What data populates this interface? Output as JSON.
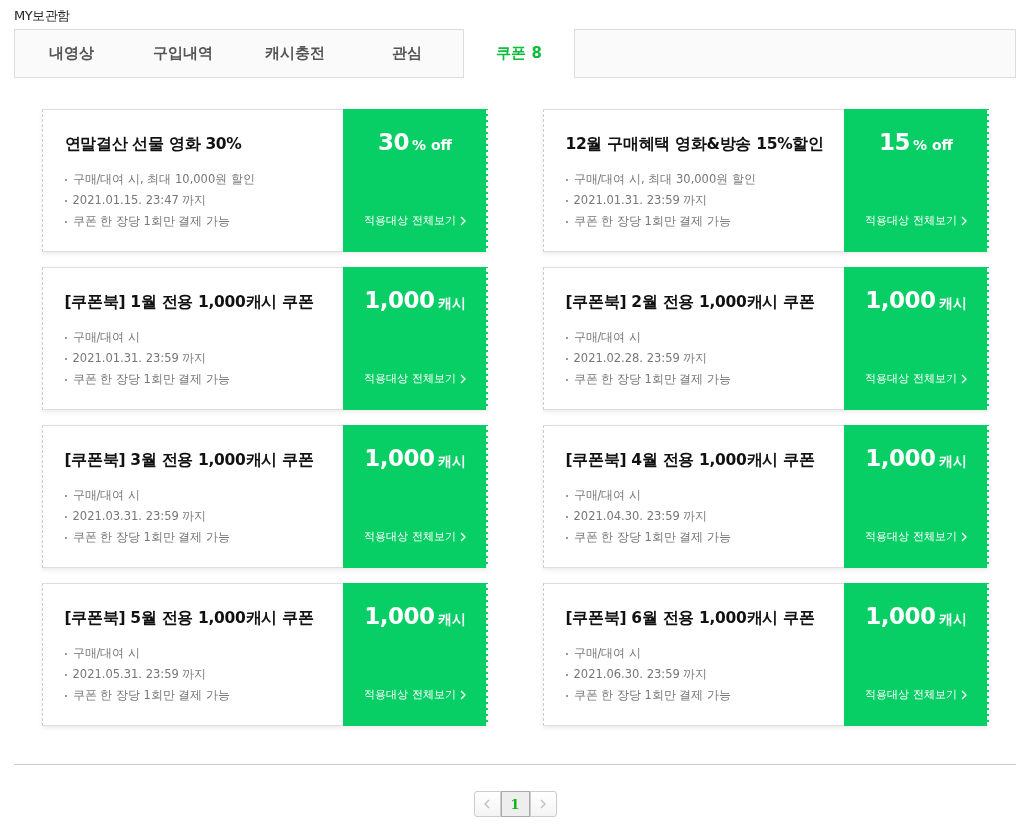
{
  "page_title": "MY보관함",
  "tabs": [
    {
      "label": "내영상",
      "selected": false
    },
    {
      "label": "구입내역",
      "selected": false
    },
    {
      "label": "캐시충전",
      "selected": false
    },
    {
      "label": "관심",
      "selected": false
    },
    {
      "label": "쿠폰 8",
      "selected": true
    }
  ],
  "coupons": [
    {
      "title": "연말결산 선물 영화 30%",
      "details": [
        "구매/대여 시, 최대 10,000원 할인",
        "2021.01.15. 23:47 까지",
        "쿠폰 한 장당 1회만 결제 가능"
      ],
      "amount": "30",
      "unit": "% off",
      "link": "적용대상 전체보기"
    },
    {
      "title": "12월 구매혜택 영화&방송 15%할인",
      "details": [
        "구매/대여 시, 최대 30,000원 할인",
        "2021.01.31. 23:59 까지",
        "쿠폰 한 장당 1회만 결제 가능"
      ],
      "amount": "15",
      "unit": "% off",
      "link": "적용대상 전체보기"
    },
    {
      "title": "[쿠폰북] 1월 전용 1,000캐시 쿠폰",
      "details": [
        "구매/대여 시",
        "2021.01.31. 23:59 까지",
        "쿠폰 한 장당 1회만 결제 가능"
      ],
      "amount": "1,000",
      "unit": "캐시",
      "link": "적용대상 전체보기"
    },
    {
      "title": "[쿠폰북] 2월 전용 1,000캐시 쿠폰",
      "details": [
        "구매/대여 시",
        "2021.02.28. 23:59 까지",
        "쿠폰 한 장당 1회만 결제 가능"
      ],
      "amount": "1,000",
      "unit": "캐시",
      "link": "적용대상 전체보기"
    },
    {
      "title": "[쿠폰북] 3월 전용 1,000캐시 쿠폰",
      "details": [
        "구매/대여 시",
        "2021.03.31. 23:59 까지",
        "쿠폰 한 장당 1회만 결제 가능"
      ],
      "amount": "1,000",
      "unit": "캐시",
      "link": "적용대상 전체보기"
    },
    {
      "title": "[쿠폰북] 4월 전용 1,000캐시 쿠폰",
      "details": [
        "구매/대여 시",
        "2021.04.30. 23:59 까지",
        "쿠폰 한 장당 1회만 결제 가능"
      ],
      "amount": "1,000",
      "unit": "캐시",
      "link": "적용대상 전체보기"
    },
    {
      "title": "[쿠폰북] 5월 전용 1,000캐시 쿠폰",
      "details": [
        "구매/대여 시",
        "2021.05.31. 23:59 까지",
        "쿠폰 한 장당 1회만 결제 가능"
      ],
      "amount": "1,000",
      "unit": "캐시",
      "link": "적용대상 전체보기"
    },
    {
      "title": "[쿠폰북] 6월 전용 1,000캐시 쿠폰",
      "details": [
        "구매/대여 시",
        "2021.06.30. 23:59 까지",
        "쿠폰 한 장당 1회만 결제 가능"
      ],
      "amount": "1,000",
      "unit": "캐시",
      "link": "적용대상 전체보기"
    }
  ],
  "pagination": {
    "pages": [
      {
        "label": "1",
        "selected": true
      }
    ]
  }
}
